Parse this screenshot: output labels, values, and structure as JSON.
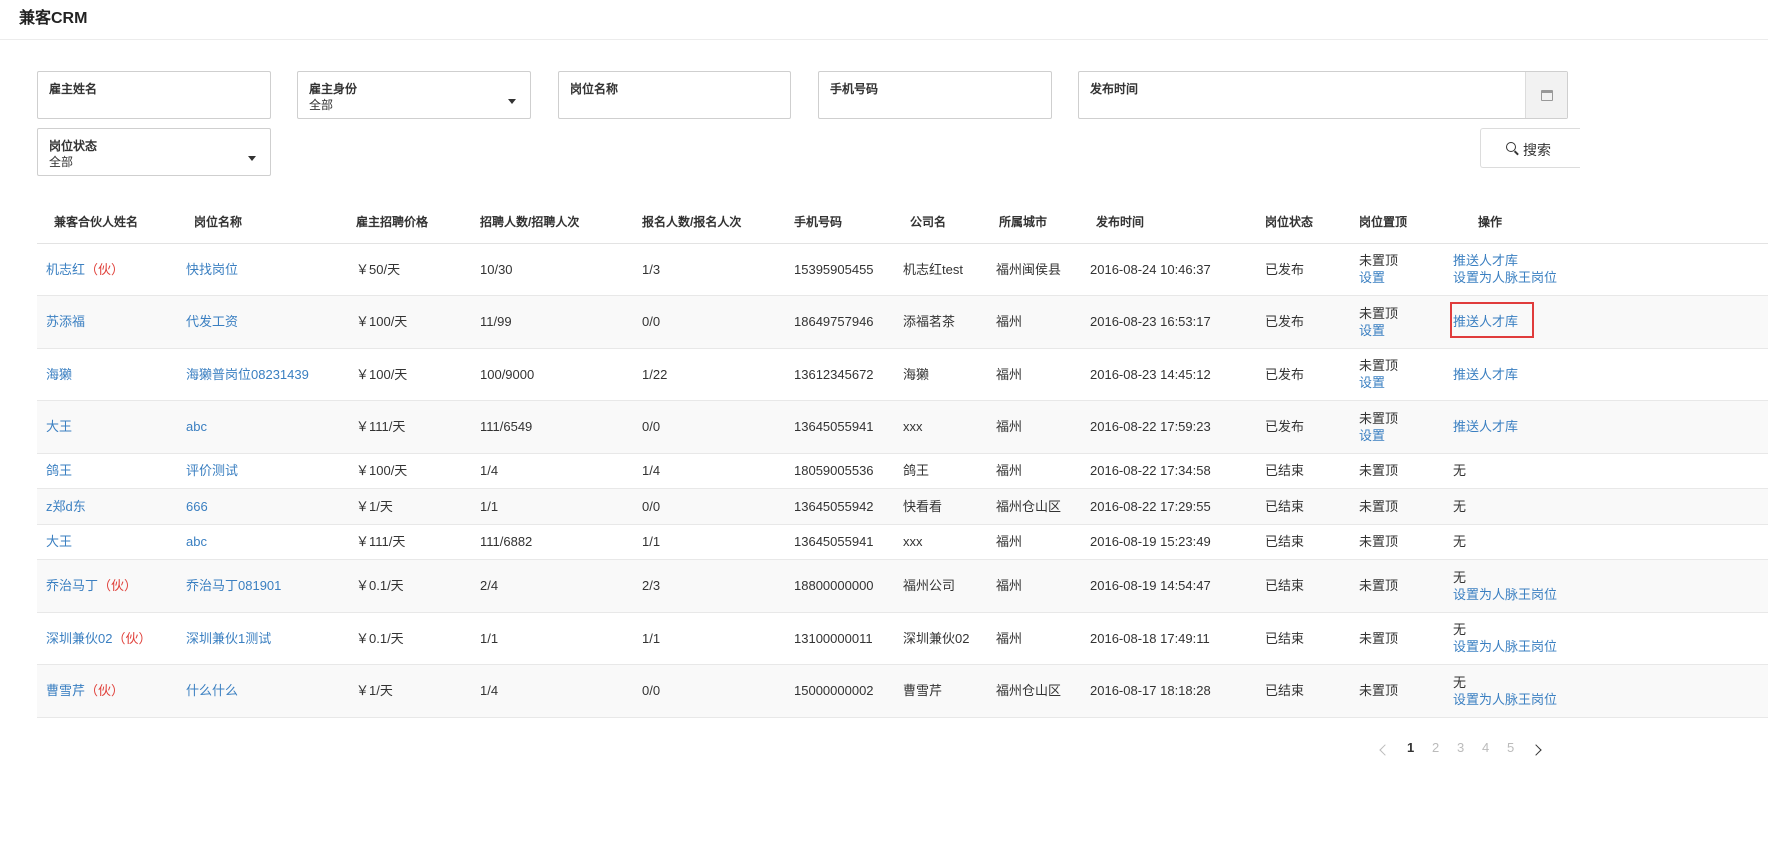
{
  "app": {
    "title": "兼客CRM"
  },
  "filters": {
    "employer_name": {
      "label": "雇主姓名",
      "value": ""
    },
    "employer_identity": {
      "label": "雇主身份",
      "value": "全部"
    },
    "job_title": {
      "label": "岗位名称",
      "value": ""
    },
    "phone": {
      "label": "手机号码",
      "value": ""
    },
    "publish_time": {
      "label": "发布时间",
      "value": ""
    },
    "job_status": {
      "label": "岗位状态",
      "value": "全部"
    },
    "search_label": "搜索"
  },
  "table": {
    "columns": [
      "兼客合伙人姓名",
      "岗位名称",
      "雇主招聘价格",
      "招聘人数/招聘人次",
      "报名人数/报名人次",
      "手机号码",
      "公司名",
      "所属城市",
      "发布时间",
      "岗位状态",
      "岗位置顶",
      "操作"
    ],
    "rows": [
      {
        "partner": "机志红",
        "tag": "（伙）",
        "job": "快找岗位",
        "price": "￥50/天",
        "recruit": "10/30",
        "apply": "1/3",
        "phone": "15395905455",
        "company": "机志红test",
        "city": "福州闽侯县",
        "time": "2016-08-24 10:46:37",
        "status": "已发布",
        "top": "未置顶",
        "top_action": "设置",
        "ops": [
          "推送人才库",
          "设置为人脉王岗位"
        ]
      },
      {
        "partner": "苏添福",
        "tag": "",
        "job": "代发工资",
        "price": "￥100/天",
        "recruit": "11/99",
        "apply": "0/0",
        "phone": "18649757946",
        "company": "添福茗茶",
        "city": "福州",
        "time": "2016-08-23 16:53:17",
        "status": "已发布",
        "top": "未置顶",
        "top_action": "设置",
        "ops": [
          "推送人才库"
        ]
      },
      {
        "partner": "海獭",
        "tag": "",
        "job": "海獭普岗位08231439",
        "price": "￥100/天",
        "recruit": "100/9000",
        "apply": "1/22",
        "phone": "13612345672",
        "company": "海獭",
        "city": "福州",
        "time": "2016-08-23 14:45:12",
        "status": "已发布",
        "top": "未置顶",
        "top_action": "设置",
        "ops": [
          "推送人才库"
        ]
      },
      {
        "partner": "大王",
        "tag": "",
        "job": "abc",
        "price": "￥111/天",
        "recruit": "111/6549",
        "apply": "0/0",
        "phone": "13645055941",
        "company": "xxx",
        "city": "福州",
        "time": "2016-08-22 17:59:23",
        "status": "已发布",
        "top": "未置顶",
        "top_action": "设置",
        "ops": [
          "推送人才库"
        ]
      },
      {
        "partner": "鸽王",
        "tag": "",
        "job": "评价测试",
        "price": "￥100/天",
        "recruit": "1/4",
        "apply": "1/4",
        "phone": "18059005536",
        "company": "鸽王",
        "city": "福州",
        "time": "2016-08-22 17:34:58",
        "status": "已结束",
        "top": "未置顶",
        "top_action": "",
        "ops": [
          "无"
        ]
      },
      {
        "partner": "z郑d东",
        "tag": "",
        "job": "666",
        "price": "￥1/天",
        "recruit": "1/1",
        "apply": "0/0",
        "phone": "13645055942",
        "company": "快看看",
        "city": "福州仓山区",
        "time": "2016-08-22 17:29:55",
        "status": "已结束",
        "top": "未置顶",
        "top_action": "",
        "ops": [
          "无"
        ]
      },
      {
        "partner": "大王",
        "tag": "",
        "job": "abc",
        "price": "￥111/天",
        "recruit": "111/6882",
        "apply": "1/1",
        "phone": "13645055941",
        "company": "xxx",
        "city": "福州",
        "time": "2016-08-19 15:23:49",
        "status": "已结束",
        "top": "未置顶",
        "top_action": "",
        "ops": [
          "无"
        ]
      },
      {
        "partner": "乔治马丁",
        "tag": "（伙）",
        "job": "乔治马丁081901",
        "price": "￥0.1/天",
        "recruit": "2/4",
        "apply": "2/3",
        "phone": "18800000000",
        "company": "福州公司",
        "city": "福州",
        "time": "2016-08-19 14:54:47",
        "status": "已结束",
        "top": "未置顶",
        "top_action": "",
        "ops": [
          "无",
          "设置为人脉王岗位"
        ]
      },
      {
        "partner": "深圳兼伙02",
        "tag": "（伙）",
        "job": "深圳兼伙1测试",
        "price": "￥0.1/天",
        "recruit": "1/1",
        "apply": "1/1",
        "phone": "13100000011",
        "company": "深圳兼伙02",
        "city": "福州",
        "time": "2016-08-18 17:49:11",
        "status": "已结束",
        "top": "未置顶",
        "top_action": "",
        "ops": [
          "无",
          "设置为人脉王岗位"
        ]
      },
      {
        "partner": "曹雪芹",
        "tag": "（伙）",
        "job": "什么什么",
        "price": "￥1/天",
        "recruit": "1/4",
        "apply": "0/0",
        "phone": "15000000002",
        "company": "曹雪芹",
        "city": "福州仓山区",
        "time": "2016-08-17 18:18:28",
        "status": "已结束",
        "top": "未置顶",
        "top_action": "",
        "ops": [
          "无",
          "设置为人脉王岗位"
        ]
      }
    ]
  },
  "pagination": {
    "current": "1",
    "pages": [
      "1",
      "2",
      "3",
      "4",
      "5"
    ]
  }
}
